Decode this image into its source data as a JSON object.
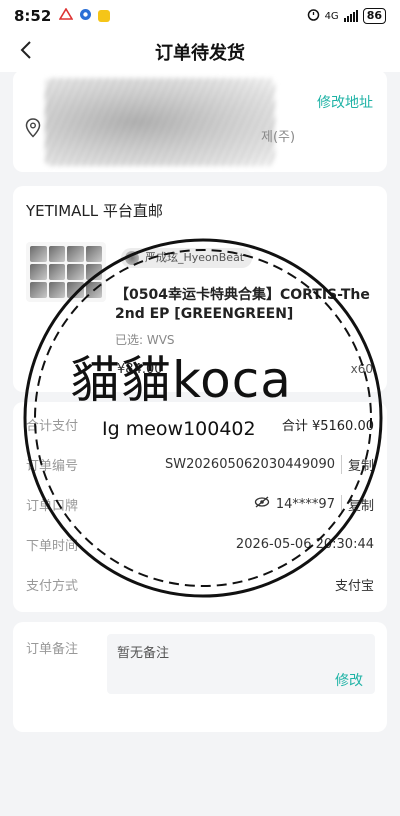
{
  "status_bar": {
    "time": "8:52",
    "network": "4G",
    "battery": "86"
  },
  "nav": {
    "title": "订单待发货",
    "back_icon": "chevron-left-icon"
  },
  "address": {
    "edit_label": "修改地址",
    "visible_suffix": "제(주)"
  },
  "order": {
    "shop_name": "YETIMALL 平台直邮",
    "seller_name": "严成玹_HyeonBeat",
    "product_title": "【0504幸运卡特典合集】CORTIS-The 2nd EP [GREENGREEN]",
    "spec": "已选: WVS",
    "price": "¥84.00",
    "quantity": "x60"
  },
  "details": {
    "total_label": "合计支付",
    "total_value": "合计 ¥5160.00",
    "order_no_label": "订单编号",
    "order_no_value": "SW202605062030449090",
    "copy_label": "复制",
    "order_code_label": "订单口牌",
    "order_code_value": "14****97",
    "order_time_label": "下单时间",
    "order_time_value": "2026-05-06 20:30:44",
    "pay_method_label": "支付方式",
    "pay_method_value": "支付宝"
  },
  "note": {
    "label": "订单备注",
    "placeholder": "暂无备注",
    "edit_label": "修改"
  },
  "watermark": {
    "main_text": "貓貓koca",
    "sub_text": "Ig meow100402"
  },
  "colors": {
    "accent": "#1fb3a6",
    "background": "#f3f4f6"
  }
}
